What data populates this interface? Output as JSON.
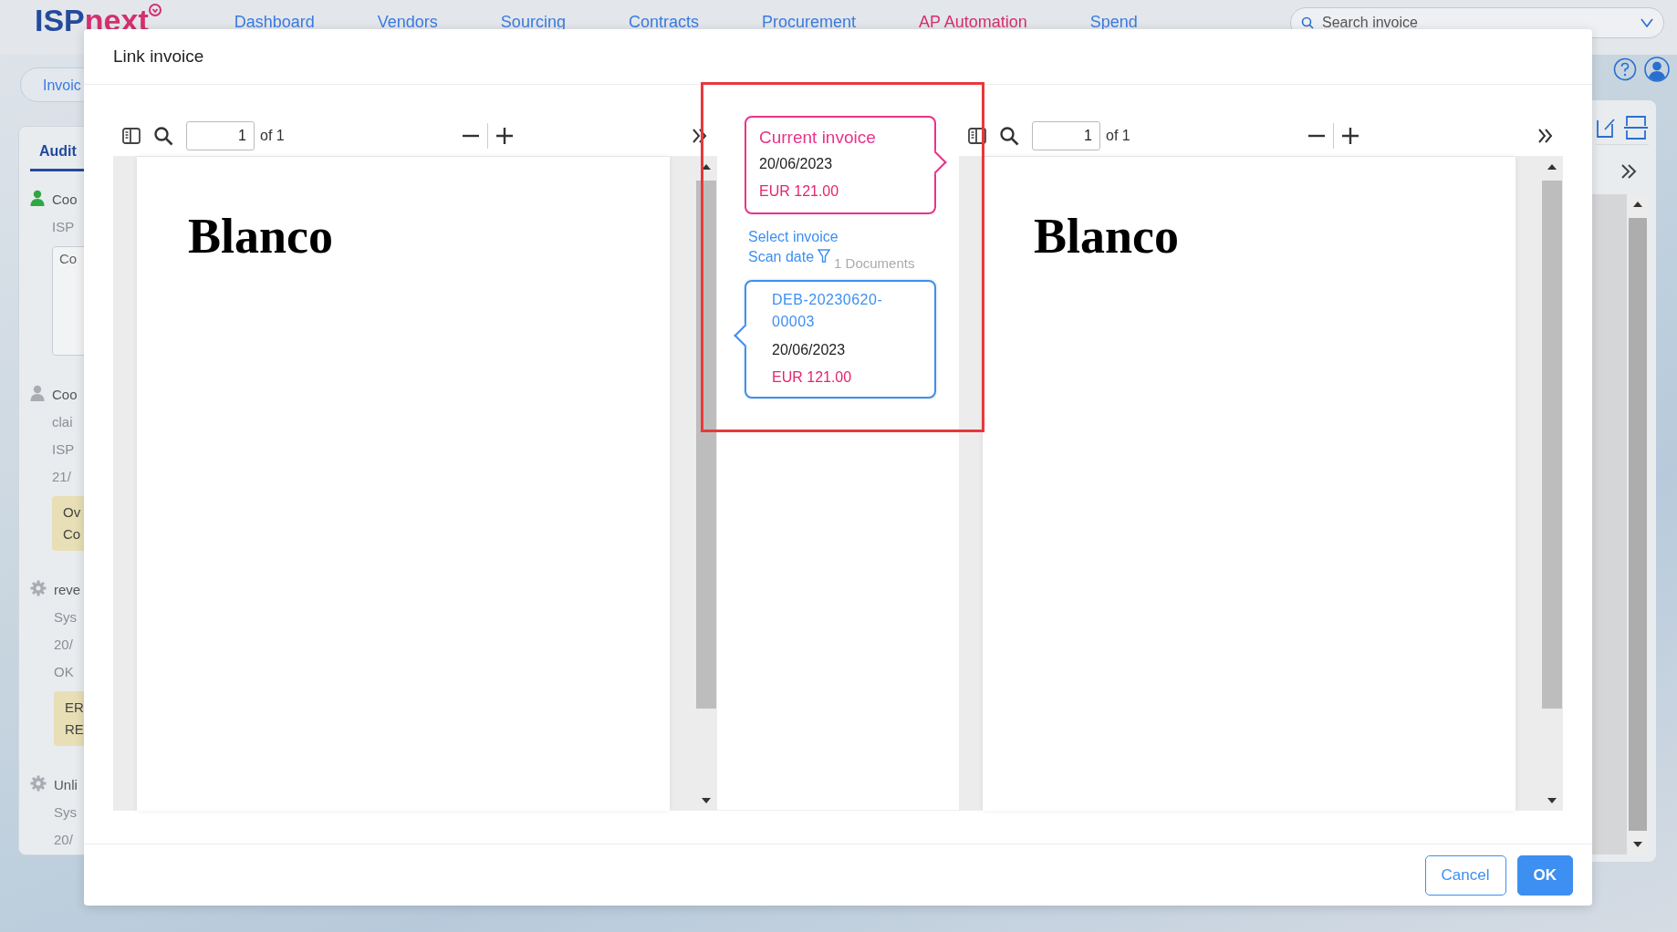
{
  "app": {
    "logo": {
      "prefix": "ISP",
      "suffix": "next"
    },
    "nav": [
      {
        "label": "Dashboard",
        "selected": false
      },
      {
        "label": "Vendors",
        "selected": false
      },
      {
        "label": "Sourcing",
        "selected": false
      },
      {
        "label": "Contracts",
        "selected": false
      },
      {
        "label": "Procurement",
        "selected": false
      },
      {
        "label": "AP Automation",
        "selected": true
      },
      {
        "label": "Spend",
        "selected": false
      }
    ],
    "search": {
      "placeholder": "Search invoice"
    }
  },
  "background": {
    "tab": "Invoic",
    "audit_tab": "Audit",
    "entries": [
      {
        "kind": "user",
        "color": "#2ea843",
        "lines": [
          "Coo",
          "ISP"
        ],
        "comment": "Co"
      },
      {
        "kind": "user",
        "color": "#a9adb3",
        "lines": [
          "Coo",
          "clai",
          "ISP",
          "21/"
        ],
        "warning": [
          "Ov",
          "Co"
        ]
      },
      {
        "kind": "system",
        "color": "#a9adb3",
        "lines": [
          "reve",
          "Sys",
          "20/",
          "OK"
        ],
        "warning": [
          "ER",
          "RE"
        ]
      },
      {
        "kind": "system",
        "color": "#a9adb3",
        "lines": [
          "Unli",
          "Sys",
          "20/"
        ]
      }
    ]
  },
  "dialog": {
    "title": "Link invoice",
    "viewers": [
      {
        "page": "1",
        "of": "of 1",
        "heading": "Blanco"
      },
      {
        "page": "1",
        "of": "of 1",
        "heading": "Blanco"
      }
    ],
    "current": {
      "label": "Current invoice",
      "date": "20/06/2023",
      "amount": "EUR 121.00"
    },
    "select_label": "Select invoice",
    "sort": "Scan date",
    "count": "1 Documents",
    "matches": [
      {
        "number": "DEB-20230620-00003",
        "date": "20/06/2023",
        "amount": "EUR 121.00"
      }
    ],
    "buttons": [
      {
        "label": "Cancel",
        "kind": "secondary"
      },
      {
        "label": "OK",
        "kind": "primary"
      }
    ]
  }
}
